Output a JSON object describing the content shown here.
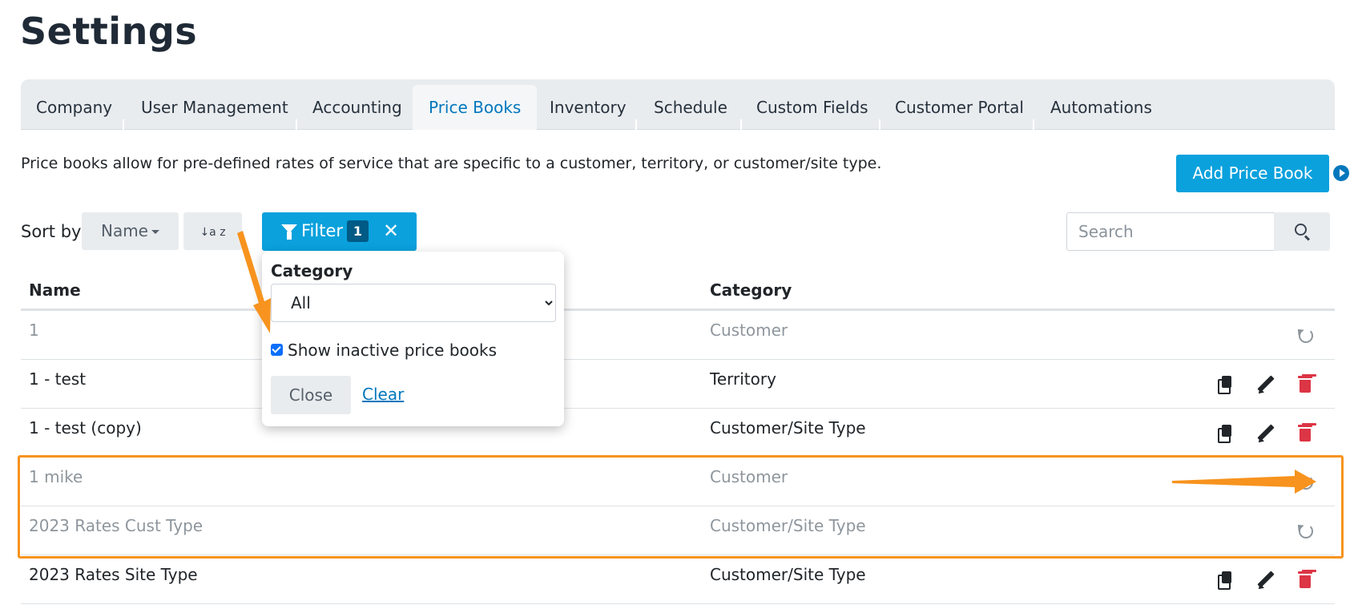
{
  "page": {
    "title": "Settings"
  },
  "tabs": [
    {
      "label": "Company"
    },
    {
      "label": "User Management"
    },
    {
      "label": "Accounting"
    },
    {
      "label": "Price Books",
      "active": true
    },
    {
      "label": "Inventory"
    },
    {
      "label": "Schedule"
    },
    {
      "label": "Custom Fields"
    },
    {
      "label": "Customer Portal"
    },
    {
      "label": "Automations"
    }
  ],
  "description": "Price books allow for pre-defined rates of service that are specific to a customer, territory, or customer/site type.",
  "add_button": "Add Price Book",
  "sort": {
    "label": "Sort by",
    "value": "Name",
    "direction_glyph": "↓a z"
  },
  "filter": {
    "label": "Filter",
    "count": "1",
    "clear_glyph": "✕"
  },
  "search": {
    "placeholder": "Search"
  },
  "popover": {
    "category_label": "Category",
    "category_value": "All",
    "show_inactive_label": "Show inactive price books",
    "show_inactive_checked": true,
    "close_label": "Close",
    "clear_label": "Clear"
  },
  "table": {
    "headers": {
      "name": "Name",
      "category": "Category"
    },
    "rows": [
      {
        "name": "1",
        "category": "Customer",
        "inactive": true
      },
      {
        "name": "1 - test",
        "category": "Territory",
        "inactive": false
      },
      {
        "name": "1 - test (copy)",
        "category": "Customer/Site Type",
        "inactive": false
      },
      {
        "name": "1 mike",
        "category": "Customer",
        "inactive": true
      },
      {
        "name": "2023 Rates Cust Type",
        "category": "Customer/Site Type",
        "inactive": true
      },
      {
        "name": "2023 Rates Site Type",
        "category": "Customer/Site Type",
        "inactive": false
      }
    ]
  },
  "colors": {
    "accent": "#0aa1dd",
    "link": "#0277bd",
    "danger": "#dc3545",
    "annotation": "#f7931e",
    "inactive_text": "#8e969d"
  },
  "icons": {
    "filter": "funnel-icon",
    "search": "search-icon",
    "restore": "restore-icon",
    "copy": "copy-icon",
    "edit": "pencil-icon",
    "delete": "trash-icon",
    "help": "play-circle-icon"
  }
}
